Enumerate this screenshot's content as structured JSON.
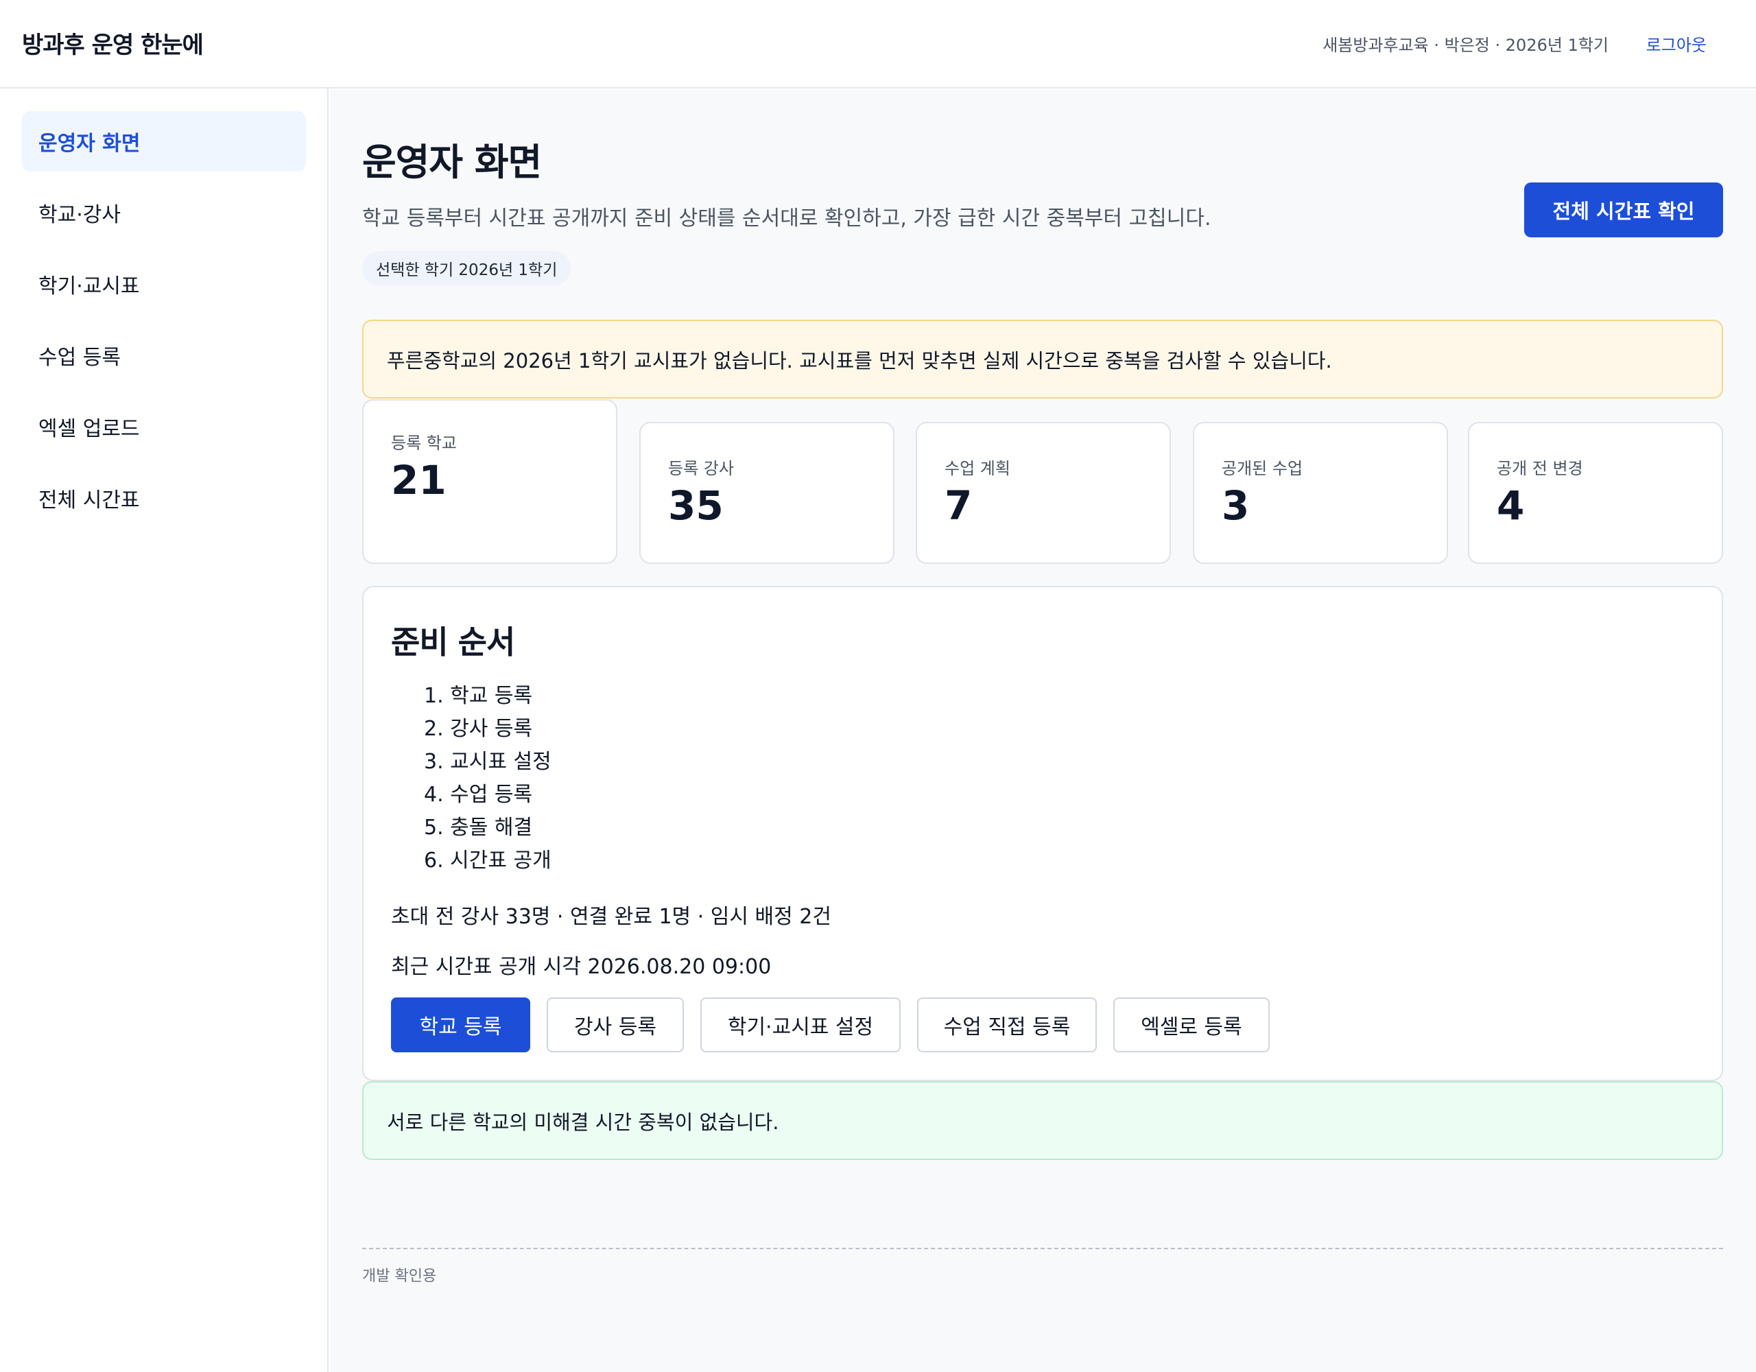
{
  "header": {
    "brand": "방과후 운영 한눈에",
    "user_info": "새봄방과후교육 · 박은정 · 2026년 1학기",
    "logout_label": "로그아웃"
  },
  "sidebar": {
    "items": [
      {
        "label": "운영자 화면",
        "active": true
      },
      {
        "label": "학교·강사",
        "active": false
      },
      {
        "label": "학기·교시표",
        "active": false
      },
      {
        "label": "수업 등록",
        "active": false
      },
      {
        "label": "엑셀 업로드",
        "active": false
      },
      {
        "label": "전체 시간표",
        "active": false
      }
    ]
  },
  "main": {
    "title": "운영자 화면",
    "description": "학교 등록부터 시간표 공개까지 준비 상태를 순서대로 확인하고, 가장 급한 시간 중복부터 고칩니다.",
    "term_chip": "선택한 학기 2026년 1학기",
    "view_all_button": "전체 시간표 확인",
    "warning": "푸른중학교의 2026년 1학기 교시표가 없습니다. 교시표를 먼저 맞추면 실제 시간으로 중복을 검사할 수 있습니다.",
    "stats": [
      {
        "label": "등록 학교",
        "value": "21"
      },
      {
        "label": "등록 강사",
        "value": "35"
      },
      {
        "label": "수업 계획",
        "value": "7"
      },
      {
        "label": "공개된 수업",
        "value": "3"
      },
      {
        "label": "공개 전 변경",
        "value": "4"
      }
    ],
    "prep": {
      "title": "준비 순서",
      "steps": [
        "1. 학교 등록",
        "2. 강사 등록",
        "3. 교시표 설정",
        "4. 수업 등록",
        "5. 충돌 해결",
        "6. 시간표 공개"
      ],
      "summary": "초대 전 강사 33명 · 연결 완료 1명 · 임시 배정 2건",
      "last_publish": "최근 시간표 공개 시각 2026.08.20 09:00",
      "buttons": [
        "학교 등록",
        "강사 등록",
        "학기·교시표 설정",
        "수업 직접 등록",
        "엑셀로 등록"
      ]
    },
    "ok_message": "서로 다른 학교의 미해결 시간 중복이 없습니다.",
    "dev_note": "개발 확인용"
  },
  "colors": {
    "accent": "#1d4ed8",
    "warning_bg": "#fff8e9",
    "warning_border": "#f7d68b",
    "success_bg": "#ecfdf3",
    "success_border": "#b7ebce"
  }
}
